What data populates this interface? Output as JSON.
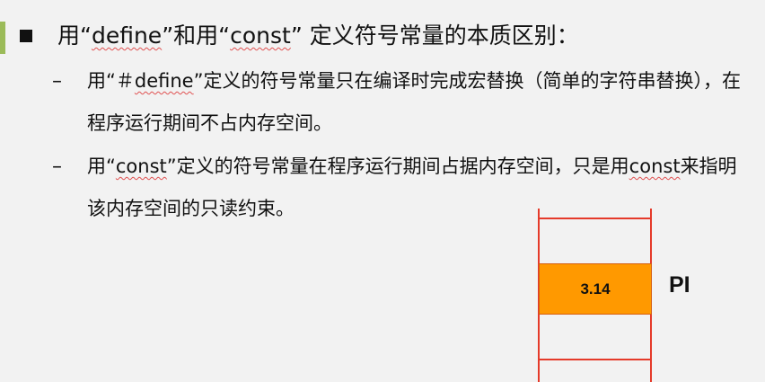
{
  "heading": {
    "t1": "用“",
    "t2": "define",
    "t3": "”和用“",
    "t4": "const",
    "t5": "” 定义符号常量的本质区别："
  },
  "items": [
    {
      "dash": "–",
      "t1": "用“＃",
      "t2": "define",
      "t3": "”定义的符号常量只在编译时完成宏替换（简单的字符串替换），在程序运行期间不占内存空间。"
    },
    {
      "dash": "–",
      "t1": "用“",
      "t2": "const",
      "t3": "”定义的符号常量在程序运行期间占据内存空间，只是用",
      "t4": "const",
      "t5": "来指明该内存空间的只读约束。"
    }
  ],
  "memory": {
    "value": "3.14",
    "name": "PI"
  },
  "colors": {
    "accent_bar": "#9bbb59",
    "memory_cell": "#ff9900",
    "memory_lines": "#e53a2a"
  }
}
